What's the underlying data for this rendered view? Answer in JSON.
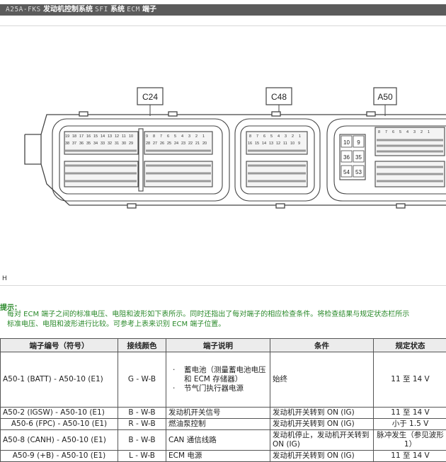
{
  "header": {
    "seg1": "A25A-FKS",
    "seg2": "发动机控制系统",
    "seg3": "SFI",
    "seg4": "系统",
    "seg5": "ECM",
    "seg6": "端子"
  },
  "figure": {
    "connectors": [
      {
        "id": "C24",
        "label": "C24"
      },
      {
        "id": "C48",
        "label": "C48"
      },
      {
        "id": "A50",
        "label": "A50"
      }
    ],
    "a50_large_pins": [
      "10",
      "9",
      "36",
      "35",
      "54",
      "53"
    ],
    "c24_upper_row1": [
      "19",
      "18",
      "17",
      "16",
      "15",
      "14",
      "13",
      "12",
      "11",
      "10"
    ],
    "c24_upper_row2": [
      "38",
      "37",
      "36",
      "35",
      "34",
      "33",
      "32",
      "31",
      "30",
      "29"
    ],
    "c24_upper_right_row1": [
      "9",
      "8",
      "7",
      "6",
      "5",
      "4",
      "3",
      "2",
      "1"
    ],
    "c24_upper_right_row2": [
      "28",
      "27",
      "26",
      "25",
      "24",
      "23",
      "22",
      "21",
      "20"
    ],
    "c48_row1": [
      "8",
      "7",
      "6",
      "5",
      "4",
      "3",
      "2",
      "1"
    ],
    "c48_row2": [
      "16",
      "15",
      "14",
      "13",
      "12",
      "11",
      "10",
      "9"
    ],
    "a50_row1": [
      "8",
      "7",
      "6",
      "5",
      "4",
      "3",
      "2",
      "1"
    ],
    "figure_code": "H"
  },
  "tip": {
    "title": "提示：",
    "line1": "每对 ECM 端子之间的标准电压、电阻和波形如下表所示。同时还指出了每对端子的相应检查条件。将检查结果与规定状态栏所示",
    "line2": "标准电压、电阻和波形进行比较。可参考上表来识别 ECM 端子位置。"
  },
  "table": {
    "headers": {
      "terminal": "端子编号（符号）",
      "wire": "接线颜色",
      "description": "端子说明",
      "condition": "条件",
      "specified": "规定状态"
    },
    "rows": [
      {
        "terminal": "A50-1 (BATT) - A50-10 (E1)",
        "wire": "G - W-B",
        "desc_items": [
          "蓄电池（测量蓄电池电压和 ECM 存储器）",
          "节气门执行器电源"
        ],
        "condition": "始终",
        "specified": "11 至 14 V"
      },
      {
        "terminal": "A50-2 (IGSW) - A50-10 (E1)",
        "wire": "B - W-B",
        "description": "发动机开关信号",
        "condition": "发动机开关转到 ON (IG)",
        "specified": "11 至 14 V"
      },
      {
        "terminal": "A50-6 (FPC) - A50-10 (E1)",
        "wire": "R - W-B",
        "description": "燃油泵控制",
        "condition": "发动机开关转到 ON (IG)",
        "specified": "小于 1.5 V"
      },
      {
        "terminal": "A50-8 (CANH) - A50-10 (E1)",
        "wire": "B - W-B",
        "description": "CAN 通信线路",
        "condition": "发动机停止，发动机开关转到 ON (IG)",
        "specified": "脉冲发生（参见波形 1）"
      },
      {
        "terminal": "A50-9 (+B) - A50-10 (E1)",
        "wire": "L - W-B",
        "description": "ECM 电源",
        "condition": "发动机开关转到 ON (IG)",
        "specified": "11 至 14 V"
      }
    ]
  },
  "colors": {
    "title_bar": "#5b5b5b",
    "tip_green": "#2b8a2b",
    "header_bg": "#ececec"
  }
}
